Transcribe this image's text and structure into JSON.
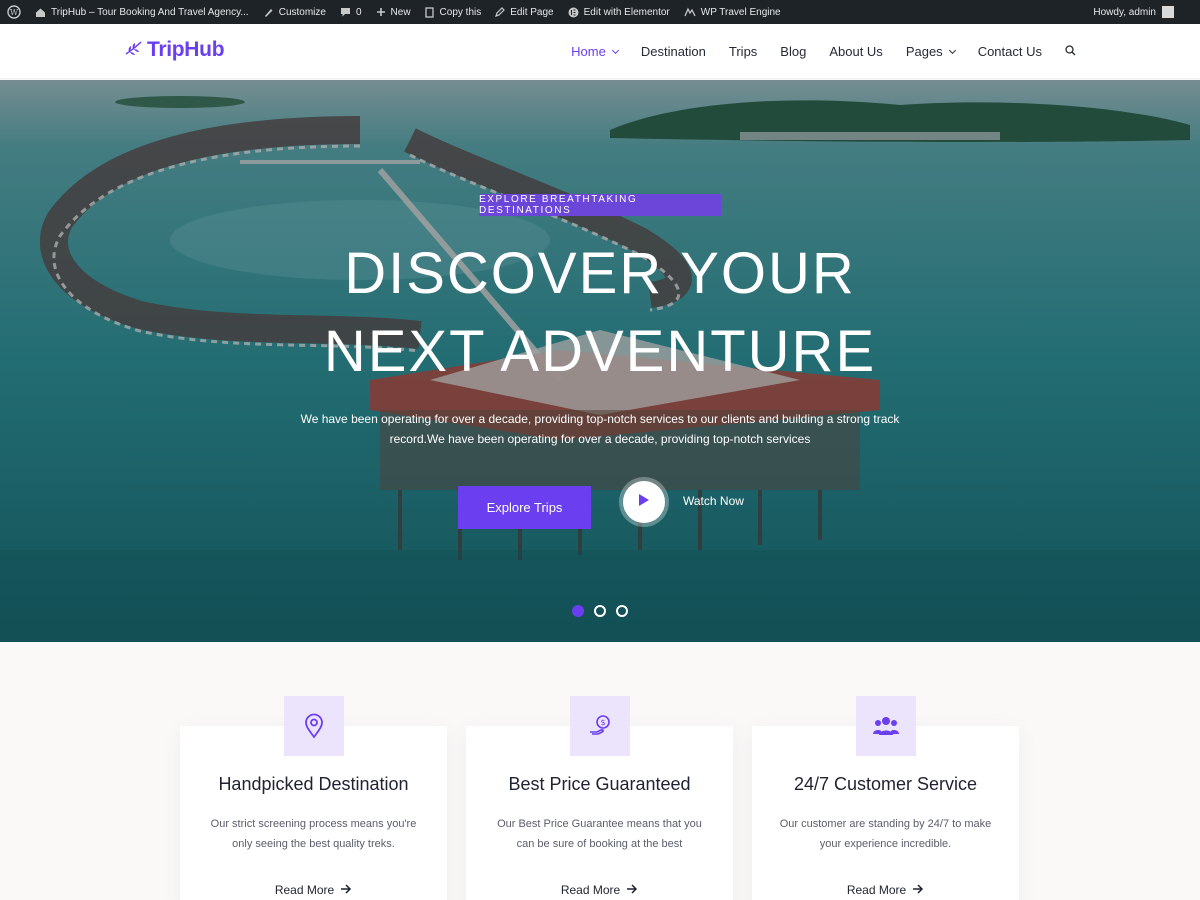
{
  "admin_bar": {
    "site_title": "TripHub – Tour Booking And Travel Agency...",
    "customize": "Customize",
    "comments_count": "0",
    "new": "New",
    "copy": "Copy this",
    "edit_page": "Edit Page",
    "elementor": "Edit with Elementor",
    "wp_travel": "WP Travel Engine",
    "howdy": "Howdy, admin"
  },
  "header": {
    "logo": "TripHub",
    "nav": [
      "Home",
      "Destination",
      "Trips",
      "Blog",
      "About Us",
      "Pages",
      "Contact Us"
    ]
  },
  "hero": {
    "eyebrow": "EXPLORE BREATHTAKING DESTINATIONS",
    "title_line1": "DISCOVER YOUR",
    "title_line2": "NEXT ADVENTURE",
    "description": "We have been operating for over a decade, providing top-notch services to our clients and building a strong track record.We have been operating for over a decade, providing top-notch services",
    "cta": "Explore Trips",
    "watch": "Watch Now",
    "slides": 3,
    "active_slide": 1
  },
  "features": [
    {
      "title": "Handpicked Destination",
      "text": "Our strict screening process means you're only seeing the best quality treks.",
      "link": "Read More",
      "icon": "map-pin-icon"
    },
    {
      "title": "Best Price Guaranteed",
      "text": "Our Best Price Guarantee means that you can be sure of booking at the best",
      "link": "Read More",
      "icon": "price-tag-icon"
    },
    {
      "title": "24/7 Customer Service",
      "text": "Our customer are standing by 24/7 to make your experience incredible.",
      "link": "Read More",
      "icon": "users-icon"
    }
  ],
  "colors": {
    "accent": "#6b3ff0",
    "admin_bar": "#1d2327",
    "icon_bg": "#ece4fd"
  }
}
